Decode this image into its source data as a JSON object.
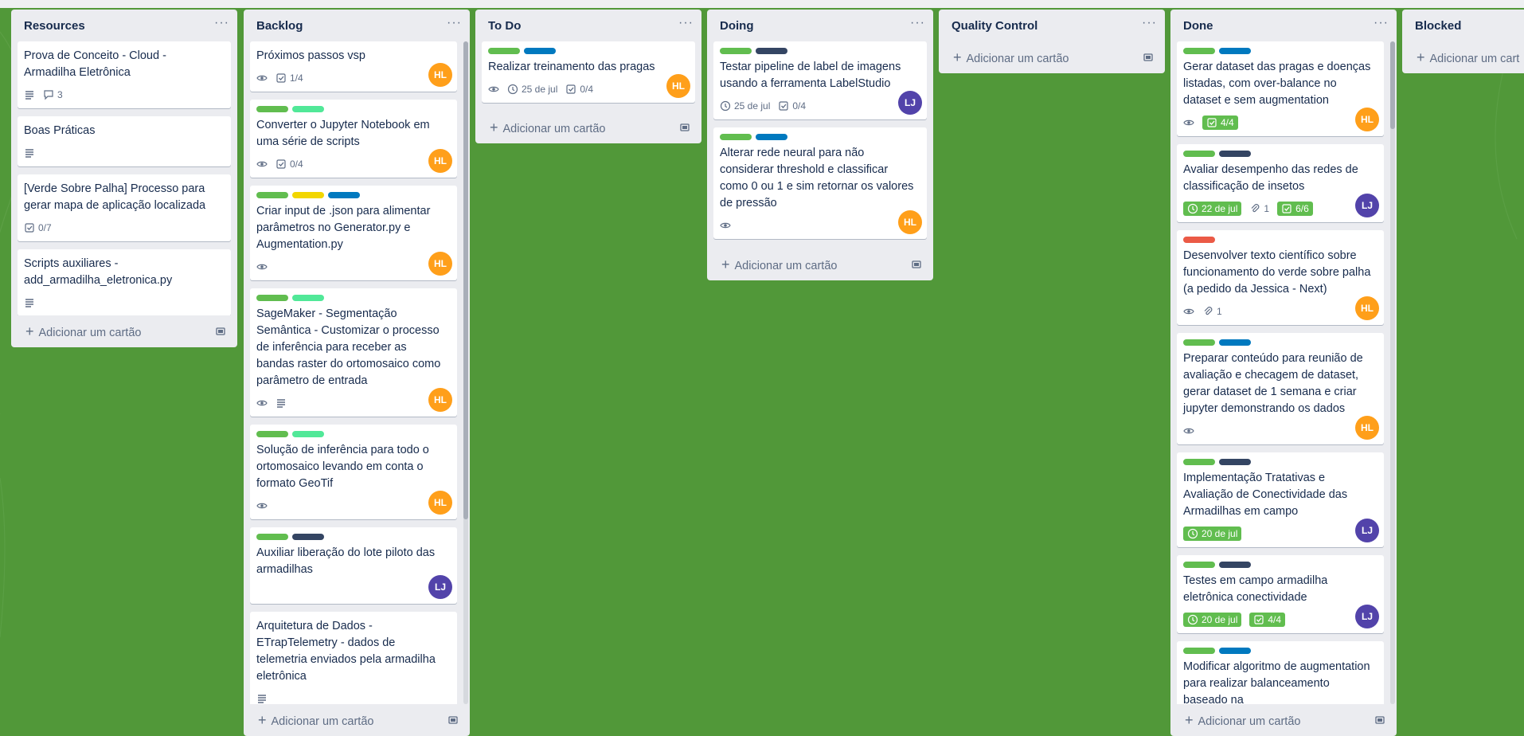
{
  "colors": {
    "board_bg": "#519839",
    "label_green": "#61bd4f",
    "label_lime": "#51e898",
    "label_yellow": "#f2d600",
    "label_blue": "#0079bf",
    "label_navy": "#344563",
    "label_red": "#eb5a46",
    "avatar_hl": "#ff9f1a",
    "avatar_lj": "#5243aa"
  },
  "ui": {
    "add_card_label": "Adicionar um cartão",
    "list_menu_glyph": "···",
    "template_icon": "card-template-icon"
  },
  "lists": {
    "resources": {
      "title": "Resources",
      "cards": [
        {
          "title": "Prova de Conceito - Cloud - Armadilha Eletrônica",
          "comments": "3"
        },
        {
          "title": "Boas Práticas"
        },
        {
          "title": "[Verde Sobre Palha] Processo para gerar mapa de aplicação localizada",
          "checklist": "0/7"
        },
        {
          "title": "Scripts auxiliares - add_armadilha_eletronica.py"
        }
      ]
    },
    "backlog": {
      "title": "Backlog",
      "cards": [
        {
          "title": "Próximos passos vsp",
          "checklist": "1/4",
          "avatar": "HL"
        },
        {
          "title": "Converter o Jupyter Notebook em uma série de scripts",
          "checklist": "0/4",
          "avatar": "HL"
        },
        {
          "title": "Criar input de .json para alimentar parâmetros no Generator.py e Augmentation.py",
          "avatar": "HL"
        },
        {
          "title": "SageMaker - Segmentação Semântica - Customizar o processo de inferência para receber as bandas raster do ortomosaico como parâmetro de entrada",
          "avatar": "HL"
        },
        {
          "title": "Solução de inferência para todo o ortomosaico levando em conta o formato GeoTif",
          "avatar": "HL"
        },
        {
          "title": "Auxiliar liberação do lote piloto das armadilhas",
          "avatar": "LJ"
        },
        {
          "title": "Arquitetura de Dados - ETrapTelemetry - dados de telemetria enviados pela armadilha eletrônica"
        }
      ]
    },
    "todo": {
      "title": "To Do",
      "cards": [
        {
          "title": "Realizar treinamento das pragas",
          "date": "25 de jul",
          "checklist": "0/4",
          "avatar": "HL"
        }
      ]
    },
    "doing": {
      "title": "Doing",
      "cards": [
        {
          "title": "Testar pipeline de label de imagens usando a ferramenta LabelStudio",
          "date": "25 de jul",
          "checklist": "0/4",
          "avatar": "LJ"
        },
        {
          "title": "Alterar rede neural para não considerar threshold e classificar como 0 ou 1 e sim retornar os valores de pressão",
          "avatar": "HL"
        }
      ]
    },
    "qc": {
      "title": "Quality Control",
      "cards": []
    },
    "done": {
      "title": "Done",
      "cards": [
        {
          "title": "Gerar dataset das pragas e doenças listadas, com over-balance no dataset e sem augmentation",
          "checklist": "4/4",
          "avatar": "HL"
        },
        {
          "title": "Avaliar desempenho das redes de classificação de insetos",
          "date": "22 de jul",
          "attachments": "1",
          "checklist": "6/6",
          "avatar": "LJ"
        },
        {
          "title": "Desenvolver texto científico sobre funcionamento do verde sobre palha (a pedido da Jessica - Next)",
          "attachments": "1",
          "avatar": "HL"
        },
        {
          "title": "Preparar conteúdo para reunião de avaliação e checagem de dataset, gerar dataset de 1 semana e criar jupyter demonstrando os dados",
          "avatar": "HL"
        },
        {
          "title": "Implementação Tratativas e Avaliação de Conectividade das Armadilhas em campo",
          "date": "20 de jul",
          "avatar": "LJ"
        },
        {
          "title": "Testes em campo armadilha eletrônica conectividade",
          "date": "20 de jul",
          "checklist": "4/4",
          "avatar": "LJ"
        },
        {
          "title": "Modificar algoritmo de augmentation para realizar balanceamento baseado na"
        }
      ]
    },
    "blocked": {
      "title": "Blocked",
      "add_label": "Adicionar um cart"
    }
  }
}
